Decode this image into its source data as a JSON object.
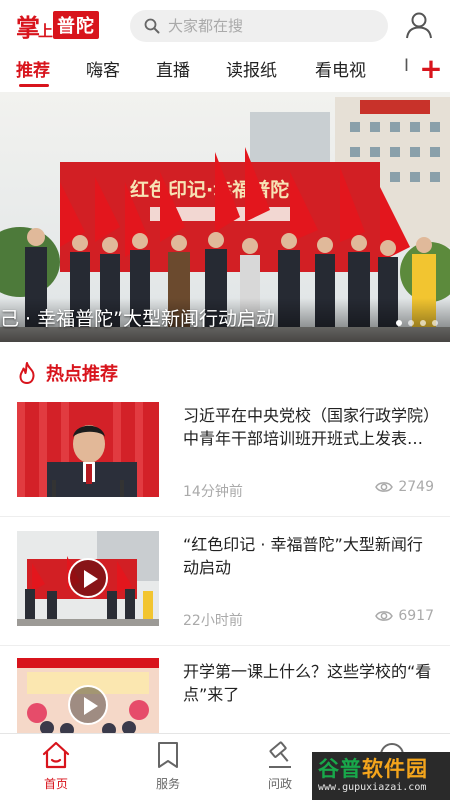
{
  "header": {
    "logo_char1": "掌",
    "logo_char2": "上",
    "logo_box": "普陀",
    "search_placeholder": "大家都在搜",
    "user_icon": "user-icon"
  },
  "tabs": [
    {
      "label": "推荐",
      "active": true
    },
    {
      "label": "嗨客",
      "active": false
    },
    {
      "label": "直播",
      "active": false
    },
    {
      "label": "读报纸",
      "active": false
    },
    {
      "label": "看电视",
      "active": false
    },
    {
      "label": "I",
      "active": false
    }
  ],
  "tab_add_label": "+",
  "banner": {
    "caption": "己 · 幸福普陀”大型新闻行动启动",
    "slide_count": 4,
    "active_slide": 0
  },
  "hot": {
    "title": "热点推荐",
    "icon": "flame-icon"
  },
  "news": [
    {
      "title": "习近平在中央党校（国家行政学院）中青年干部培训班开班式上发表重要讲话",
      "time": "14分钟前",
      "views": "2749",
      "video": false
    },
    {
      "title": "“红色印记 · 幸福普陀”大型新闻行动启动",
      "time": "22小时前",
      "views": "6917",
      "video": true
    },
    {
      "title": "开学第一课上什么？这些学校的“看点”来了",
      "time": "",
      "views": "",
      "video": true
    }
  ],
  "bottom_nav": [
    {
      "label": "首页",
      "icon": "home-icon",
      "active": true
    },
    {
      "label": "服务",
      "icon": "bookmark-icon",
      "active": false
    },
    {
      "label": "问政",
      "icon": "gavel-icon",
      "active": false
    },
    {
      "label": "",
      "icon": "chat-icon",
      "active": false
    }
  ],
  "watermark": {
    "title_green": "谷普",
    "title_orange": "软件园",
    "url": "www.gupuxiazai.com"
  },
  "colors": {
    "brand_red": "#d8141c",
    "muted_text": "#aaaaaa",
    "search_bg": "#efefef"
  }
}
